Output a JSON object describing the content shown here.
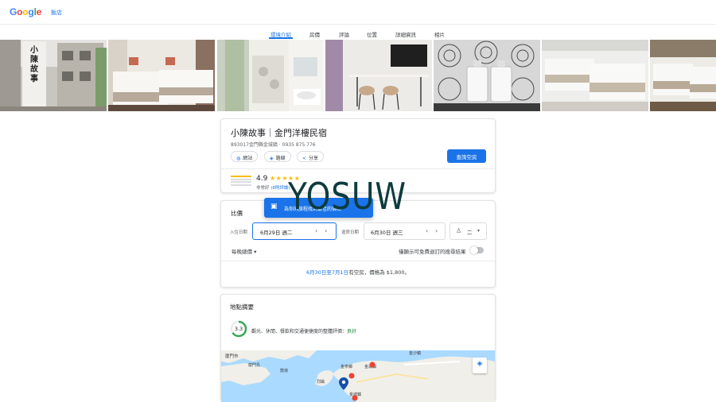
{
  "header": {
    "logo_text": "Google",
    "nav_link": "飯店"
  },
  "tabs": [
    "環境介紹",
    "房價",
    "評論",
    "位置",
    "詳細資訊",
    "相片"
  ],
  "hotel": {
    "title": "小陳故事｜金門洋樓民宿",
    "address": "893017金門縣金城鎮 · 0935 875 776",
    "actions": {
      "website": "網站",
      "directions": "路線",
      "share": "分享"
    },
    "check_button": "查詢空房",
    "rating": "4.9",
    "stars": "★★★★★",
    "rating_text": "非常好",
    "reviews_link": "(8則評論)",
    "sign_text": "小陳故事"
  },
  "prices": {
    "title": "比價",
    "checkin_label": "入住日期",
    "checkin_value": "6月29日 週二",
    "checkout_label": "退房日期",
    "checkout_value": "6月30日 週三",
    "guests_value": "二",
    "per_night": "每晚總價",
    "free_cancel": "僅顯示可免費退訂的搜尋結果",
    "availability_dates": "6月30日至7月1日",
    "availability_rest": "有空房，價格為 $1,800。",
    "tooltip": "為你的旅程找到最佳的價格"
  },
  "location": {
    "title": "地點摘要",
    "score": "3.3",
    "desc": "觀光、休閒、餐飲和交通便捷度的整體評價：",
    "verdict": "良好",
    "map_labels": [
      "廈門市",
      "廈門島",
      "鼓浪",
      "金城鎮",
      "金湖鎮",
      "金寧鄉",
      "金沙鎮",
      "烈嶼"
    ]
  },
  "watermark": "YOSUW",
  "colors": {
    "accent": "#1a73e8",
    "star": "#fbbc04",
    "map_water": "#aadaff",
    "map_land": "#f1efe9"
  }
}
